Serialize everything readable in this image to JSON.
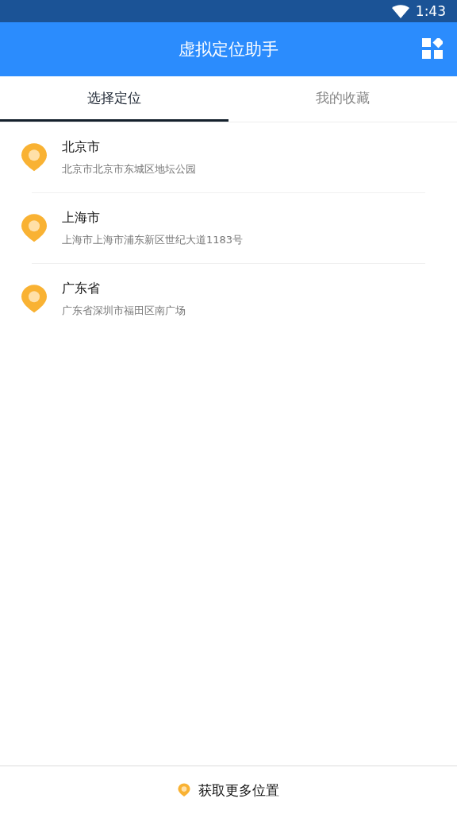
{
  "status_bar": {
    "time": "1:43"
  },
  "app_bar": {
    "title": "虚拟定位助手"
  },
  "tabs": [
    {
      "label": "选择定位",
      "selected": true
    },
    {
      "label": "我的收藏",
      "selected": false
    }
  ],
  "locations": [
    {
      "name": "北京市",
      "address": "北京市北京市东城区地坛公园"
    },
    {
      "name": "上海市",
      "address": "上海市上海市浦东新区世纪大道1183号"
    },
    {
      "name": "广东省",
      "address": "广东省深圳市福田区南广场"
    }
  ],
  "bottom_button": {
    "label": "获取更多位置"
  }
}
